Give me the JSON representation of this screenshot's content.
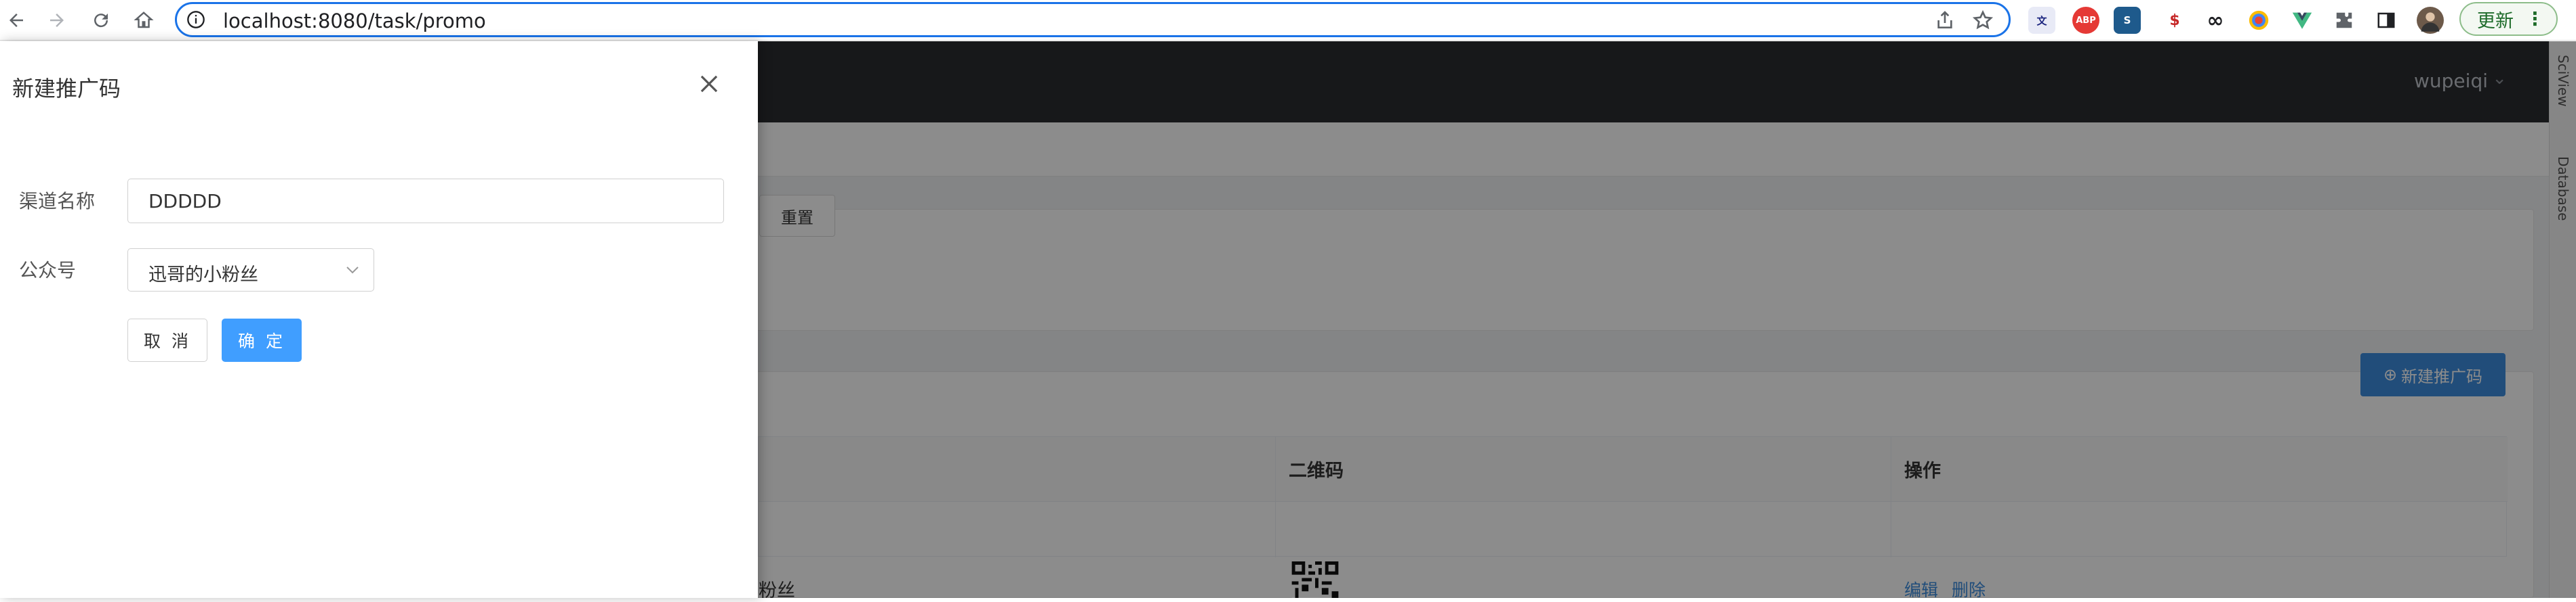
{
  "browser": {
    "url": "localhost:8080/task/promo",
    "update_label": "更新",
    "extensions": [
      "translate-icon",
      "adblock-icon",
      "s-extension-icon",
      "price-extension-icon",
      "infinity-icon",
      "color-picker-icon",
      "vue-devtools-icon",
      "puzzle-icon",
      "sidebar-icon",
      "profile-avatar"
    ]
  },
  "header": {
    "username": "wupeiqi"
  },
  "filter": {
    "reset_label": "重置"
  },
  "toolbar": {
    "new_label": "新建推广码"
  },
  "table": {
    "columns": [
      "二维码",
      "操作"
    ],
    "rows": [
      {
        "name_partial": "粉丝",
        "actions": [
          "编辑",
          "删除"
        ]
      }
    ]
  },
  "side_panels": [
    "SciView",
    "Database"
  ],
  "drawer": {
    "title": "新建推广码",
    "fields": {
      "channel_label": "渠道名称",
      "channel_value": "DDDDD",
      "account_label": "公众号",
      "account_value": "迅哥的小粉丝"
    },
    "cancel_label": "取 消",
    "ok_label": "确 定"
  },
  "colors": {
    "primary": "#409eff",
    "header_bg": "#2a2d31",
    "url_focus": "#1a73e8"
  }
}
